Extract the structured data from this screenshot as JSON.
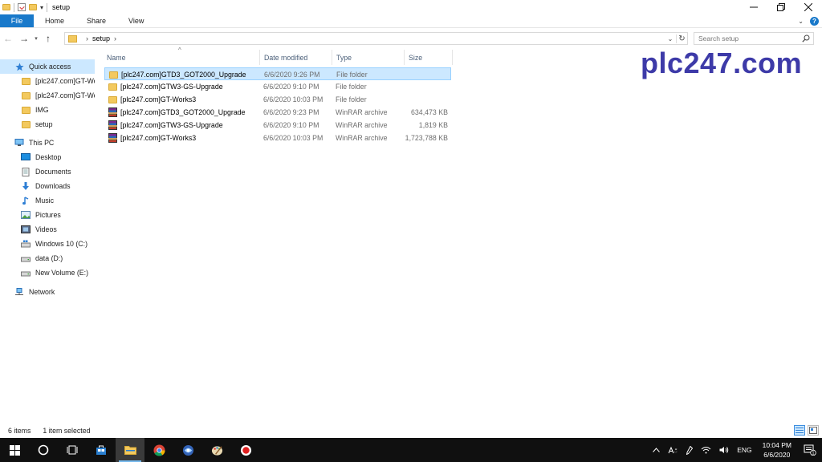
{
  "window": {
    "title": "setup",
    "controls": [
      "minimize",
      "maximize",
      "close"
    ]
  },
  "ribbon": {
    "file": "File",
    "tabs": [
      "Home",
      "Share",
      "View"
    ]
  },
  "address": {
    "path": "setup",
    "search_placeholder": "Search setup"
  },
  "nav": {
    "quick_access": "Quick access",
    "quick_items": [
      "[plc247.com]GT-Wo",
      "[plc247.com]GT-Wo",
      "IMG",
      "setup"
    ],
    "this_pc": "This PC",
    "pc_items": [
      "Desktop",
      "Documents",
      "Downloads",
      "Music",
      "Pictures",
      "Videos",
      "Windows 10 (C:)",
      "data (D:)",
      "New Volume (E:)"
    ],
    "network": "Network"
  },
  "columns": {
    "name": "Name",
    "date": "Date modified",
    "type": "Type",
    "size": "Size"
  },
  "files": [
    {
      "name": "[plc247.com]GTD3_GOT2000_Upgrade",
      "date": "6/6/2020 9:26 PM",
      "type": "File folder",
      "size": "",
      "icon": "folder",
      "selected": true
    },
    {
      "name": "[plc247.com]GTW3-GS-Upgrade",
      "date": "6/6/2020 9:10 PM",
      "type": "File folder",
      "size": "",
      "icon": "folder",
      "selected": false
    },
    {
      "name": "[plc247.com]GT-Works3",
      "date": "6/6/2020 10:03 PM",
      "type": "File folder",
      "size": "",
      "icon": "folder",
      "selected": false
    },
    {
      "name": "[plc247.com]GTD3_GOT2000_Upgrade",
      "date": "6/6/2020 9:23 PM",
      "type": "WinRAR archive",
      "size": "634,473 KB",
      "icon": "winrar",
      "selected": false
    },
    {
      "name": "[plc247.com]GTW3-GS-Upgrade",
      "date": "6/6/2020 9:10 PM",
      "type": "WinRAR archive",
      "size": "1,819 KB",
      "icon": "winrar",
      "selected": false
    },
    {
      "name": "[plc247.com]GT-Works3",
      "date": "6/6/2020 10:03 PM",
      "type": "WinRAR archive",
      "size": "1,723,788 KB",
      "icon": "winrar",
      "selected": false
    }
  ],
  "watermark": "plc247.com",
  "status": {
    "count": "6 items",
    "selection": "1 item selected"
  },
  "taskbar": {
    "apps": [
      "start-icon",
      "cortana-icon",
      "task-view-icon",
      "store-icon",
      "file-explorer-icon",
      "chrome-icon",
      "app-icon",
      "paint-icon",
      "record-icon"
    ],
    "lang": "ENG",
    "time": "10:04 PM",
    "date": "6/6/2020",
    "notification_count": "1"
  },
  "colors": {
    "accent": "#1979ca",
    "selection": "#cce8ff",
    "watermark": "#3d3aa8"
  }
}
